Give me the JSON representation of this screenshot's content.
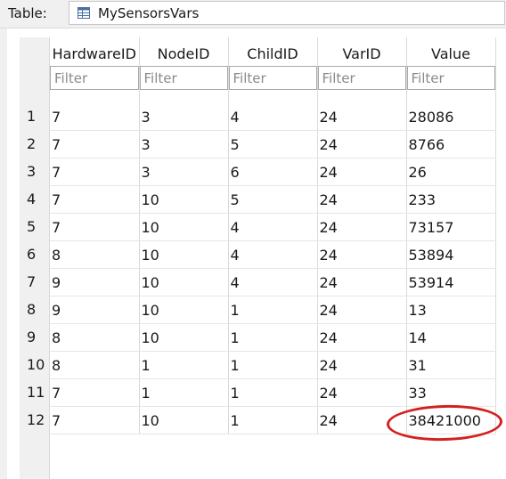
{
  "toolbar": {
    "table_label": "Table:",
    "table_name": "MySensorsVars"
  },
  "columns": [
    {
      "label": "HardwareID",
      "filter_placeholder": "Filter"
    },
    {
      "label": "NodeID",
      "filter_placeholder": "Filter"
    },
    {
      "label": "ChildID",
      "filter_placeholder": "Filter"
    },
    {
      "label": "VarID",
      "filter_placeholder": "Filter"
    },
    {
      "label": "Value",
      "filter_placeholder": "Filter"
    }
  ],
  "rows": [
    {
      "num": "1",
      "cells": [
        "7",
        "3",
        "4",
        "24",
        "28086"
      ]
    },
    {
      "num": "2",
      "cells": [
        "7",
        "3",
        "5",
        "24",
        "8766"
      ]
    },
    {
      "num": "3",
      "cells": [
        "7",
        "3",
        "6",
        "24",
        "26"
      ]
    },
    {
      "num": "4",
      "cells": [
        "7",
        "10",
        "5",
        "24",
        "233"
      ]
    },
    {
      "num": "5",
      "cells": [
        "7",
        "10",
        "4",
        "24",
        "73157"
      ]
    },
    {
      "num": "6",
      "cells": [
        "8",
        "10",
        "4",
        "24",
        "53894"
      ]
    },
    {
      "num": "7",
      "cells": [
        "9",
        "10",
        "4",
        "24",
        "53914"
      ]
    },
    {
      "num": "8",
      "cells": [
        "9",
        "10",
        "1",
        "24",
        "13"
      ]
    },
    {
      "num": "9",
      "cells": [
        "8",
        "10",
        "1",
        "24",
        "14"
      ]
    },
    {
      "num": "10",
      "cells": [
        "8",
        "1",
        "1",
        "24",
        "31"
      ]
    },
    {
      "num": "11",
      "cells": [
        "7",
        "1",
        "1",
        "24",
        "33"
      ]
    },
    {
      "num": "12",
      "cells": [
        "7",
        "10",
        "1",
        "24",
        "38421000"
      ]
    }
  ],
  "highlight": {
    "color": "#d42020"
  }
}
